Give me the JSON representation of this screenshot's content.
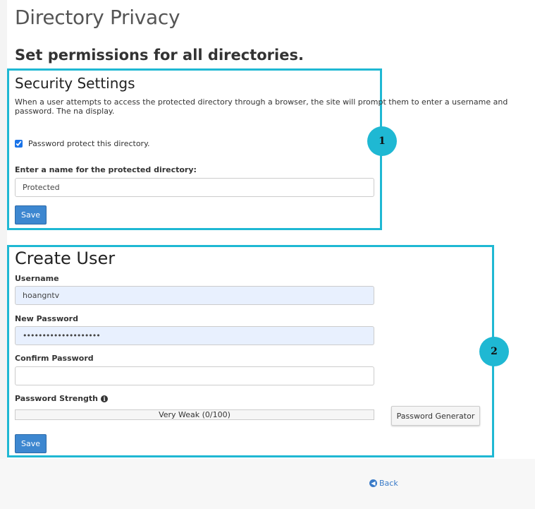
{
  "page": {
    "title": "Directory Privacy",
    "subtitle": "Set permissions for all directories."
  },
  "security_settings": {
    "heading": "Security Settings",
    "description": "When a user attempts to access the protected directory through a browser, the site will prompt them to enter a username and password. The na display.",
    "checkbox_label": "Password protect this directory.",
    "checkbox_checked": true,
    "name_label": "Enter a name for the protected directory:",
    "name_value": "Protected",
    "save_label": "Save"
  },
  "create_user": {
    "heading": "Create User",
    "username_label": "Username",
    "username_value": "hoangntv",
    "new_password_label": "New Password",
    "new_password_value": "••••••••••••••••••••",
    "confirm_password_label": "Confirm Password",
    "confirm_password_value": "",
    "strength_label": "Password Strength",
    "strength_text": "Very Weak (0/100)",
    "strength_fraction": 0,
    "generator_label": "Password Generator",
    "save_label": "Save"
  },
  "annotations": {
    "callout_1": "1",
    "callout_2": "2"
  },
  "back_label": "Back",
  "colors": {
    "highlight": "#1fb8d3",
    "primary_button": "#3d87d0",
    "link": "#3a7bc8",
    "autofill_background": "#e8f0fe"
  },
  "icons": {
    "info": "info-icon",
    "back": "back-arrow-icon"
  }
}
